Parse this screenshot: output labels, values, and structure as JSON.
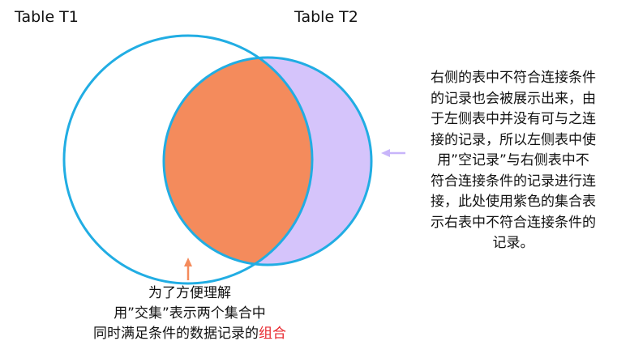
{
  "labels": {
    "table_left": "Table T1",
    "table_right": "Table T2"
  },
  "right_note": {
    "lines": [
      "右侧的表中不符合连接条件",
      "的记录也会被展示出来，由",
      "于左侧表中并没有可与之连",
      "接的记录，所以左侧表中使",
      "用”空记录”与右侧表中不",
      "符合连接条件的记录进行连",
      "接，此处使用紫色的集合表",
      "示右表中不符合连接条件的",
      "记录。"
    ]
  },
  "bottom_note": {
    "line1": "为了方便理解",
    "line2": "用”交集”表示两个集合中",
    "line3_prefix": "同时满足条件的数据记录的",
    "line3_highlight": "组合"
  },
  "colors": {
    "circle_stroke": "#21ade3",
    "intersection_fill": "#f48b5c",
    "right_only_fill": "#d5c4fb",
    "left_fill": "#ffffff",
    "purple_arrow": "#c8b5fa",
    "orange_arrow": "#f48b5c",
    "highlight_text": "#e8262d"
  }
}
